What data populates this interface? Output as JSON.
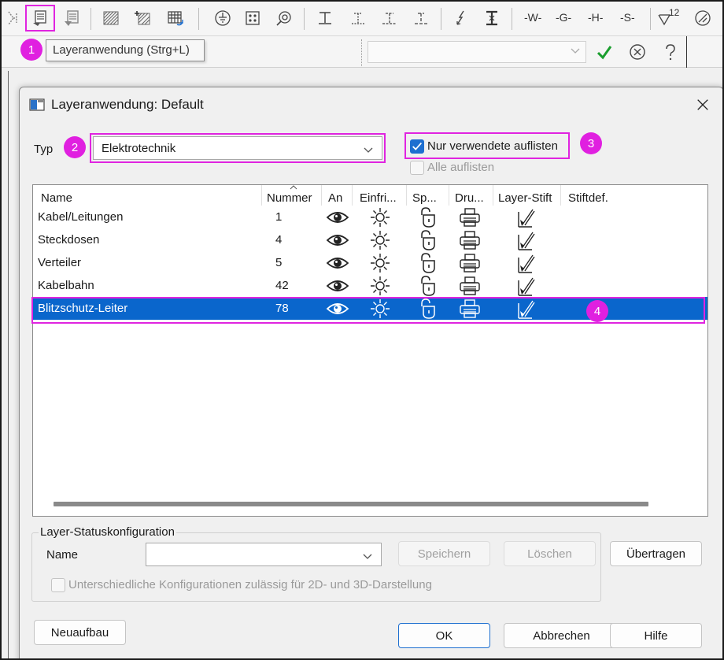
{
  "toolbar": {
    "text_buttons": [
      "-W-",
      "-G-",
      "-H-",
      "-S-"
    ],
    "number_label": "12",
    "tooltip": "Layeranwendung (Strg+L)"
  },
  "markers": [
    "1",
    "2",
    "3",
    "4"
  ],
  "dialog": {
    "title": "Layeranwendung: Default",
    "type_label": "Typ",
    "type_value": "Elektrotechnik",
    "only_used_label": "Nur verwendete auflisten",
    "only_used_checked": true,
    "list_all_label": "Alle auflisten",
    "list_all_checked": false,
    "columns": [
      "Name",
      "Nummer",
      "An",
      "Einfri...",
      "Sp...",
      "Dru...",
      "Layer-Stift",
      "Stiftdef."
    ],
    "rows": [
      {
        "name": "Kabel/Leitungen",
        "number": "1",
        "selected": false
      },
      {
        "name": "Steckdosen",
        "number": "4",
        "selected": false
      },
      {
        "name": "Verteiler",
        "number": "5",
        "selected": false
      },
      {
        "name": "Kabelbahn",
        "number": "42",
        "selected": false
      },
      {
        "name": "Blitzschutz-Leiter",
        "number": "78",
        "selected": true
      }
    ],
    "status_group": {
      "title": "Layer-Statuskonfiguration",
      "name_label": "Name",
      "name_value": "",
      "save_label": "Speichern",
      "delete_label": "Löschen",
      "transfer_label": "Übertragen",
      "allow_configs_label": "Unterschiedliche Konfigurationen zulässig für 2D- und 3D-Darstellung"
    },
    "rebuild_label": "Neuaufbau",
    "ok_label": "OK",
    "cancel_label": "Abbrechen",
    "help_label": "Hilfe"
  },
  "colors": {
    "highlight": "#e024e0",
    "selection": "#0a66cc",
    "check_green": "#1a9e2e",
    "checkbox_blue": "#1e6fd0"
  }
}
